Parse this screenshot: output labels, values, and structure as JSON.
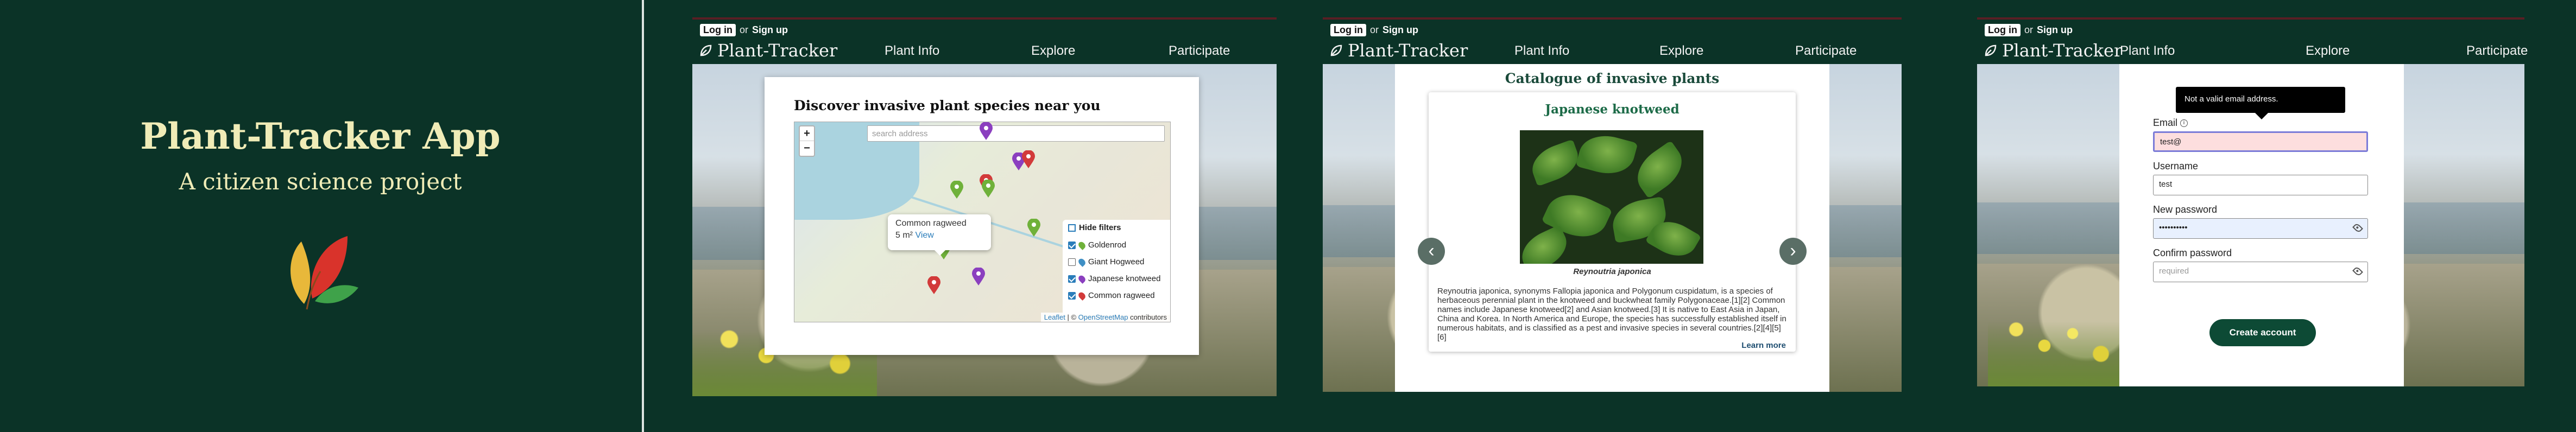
{
  "hero": {
    "title": "Plant-Tracker App",
    "subtitle": "A citizen science project"
  },
  "site": {
    "login": "Log in",
    "or": "or",
    "signup": "Sign up",
    "brand": "Plant-Tracker",
    "nav": [
      "Plant Info",
      "Explore",
      "Participate"
    ]
  },
  "explore": {
    "heading": "Discover invasive plant species near you",
    "search_placeholder": "search address",
    "zoom_in": "+",
    "zoom_out": "−",
    "popup": {
      "species": "Common ragweed",
      "area": "5 m²",
      "link": "View"
    },
    "filters": {
      "toggle": "Hide filters",
      "items": [
        {
          "label": "Goldenrod",
          "checked": true,
          "color": "#6fb13a"
        },
        {
          "label": "Giant Hogweed",
          "checked": false,
          "color": "#3f8fc4"
        },
        {
          "label": "Japanese knotweed",
          "checked": true,
          "color": "#8b3fbf"
        },
        {
          "label": "Common ragweed",
          "checked": true,
          "color": "#d23a3a"
        }
      ]
    },
    "attribution": {
      "leaflet": "Leaflet",
      "sep": "| ©",
      "osm": "OpenStreetMap",
      "suffix": "contributors"
    }
  },
  "catalogue": {
    "heading": "Catalogue of invasive plants",
    "plant": {
      "name": "Japanese knotweed",
      "caption": "Reynoutria japonica",
      "description": "Reynoutria japonica, synonyms Fallopia japonica and Polygonum cuspidatum, is a species of herbaceous perennial plant in the knotweed and buckwheat family Polygonaceae.[1][2] Common names include Japanese knotweed[2] and Asian knotweed.[3] It is native to East Asia in Japan, China and Korea. In North America and Europe, the species has successfully established itself in numerous habitats, and is classified as a pest and invasive species in several countries.[2][4][5][6]",
      "learn_more": "Learn more"
    },
    "prev": "‹",
    "next": "›"
  },
  "signup": {
    "tooltip": "Not a valid email address.",
    "email_label": "Email",
    "email_value": "test@",
    "username_label": "Username",
    "username_value": "test",
    "password_label": "New password",
    "password_value": "••••••••••",
    "confirm_label": "Confirm password",
    "confirm_placeholder": "required",
    "submit": "Create account"
  }
}
